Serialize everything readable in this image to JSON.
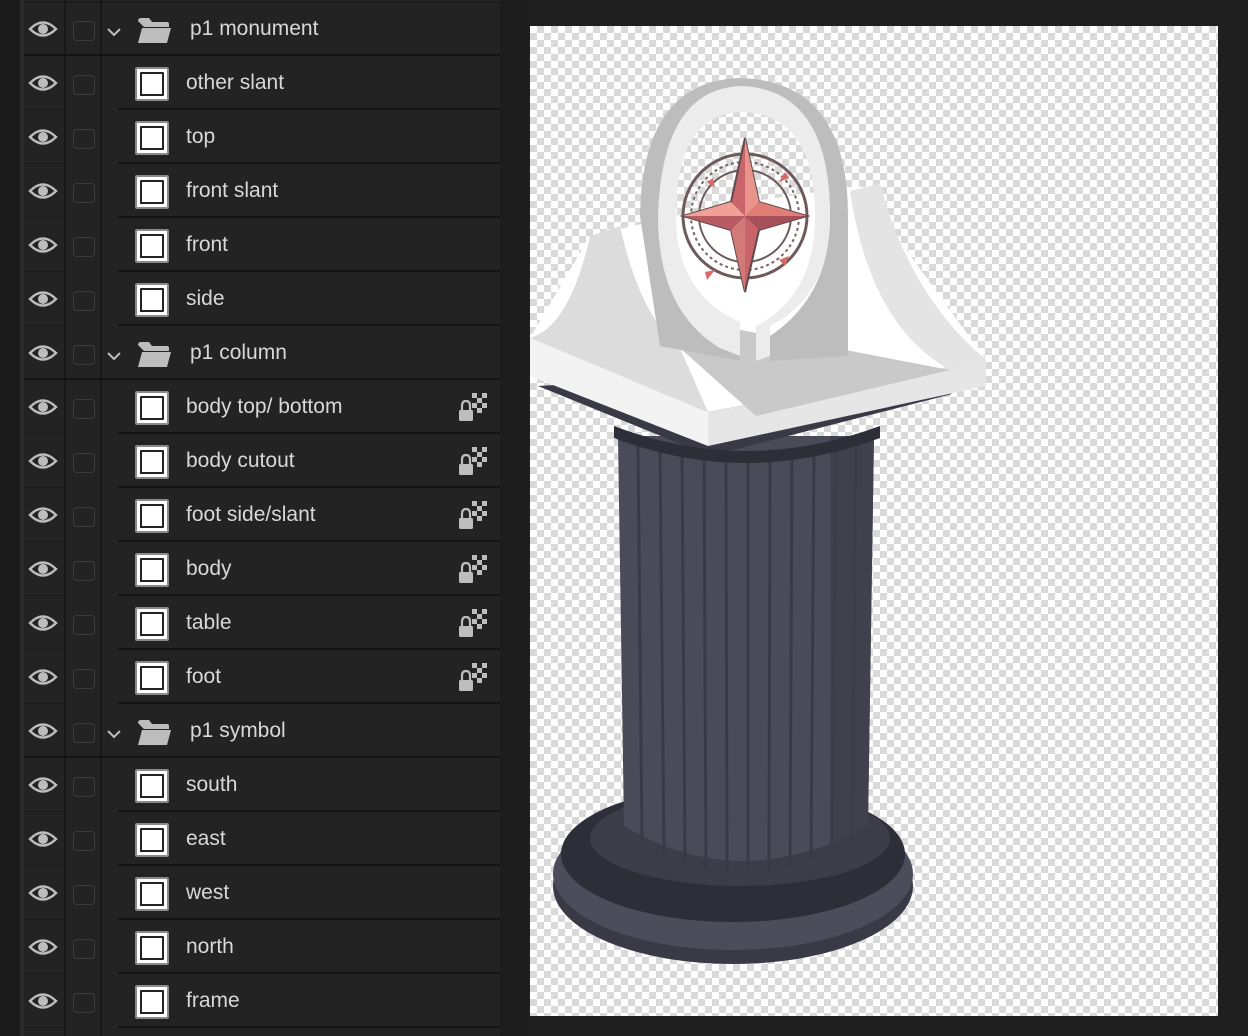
{
  "layers_panel": {
    "groups": [
      {
        "name": "p1 monument",
        "expanded": true,
        "layers": [
          {
            "name": "other slant",
            "locked": false
          },
          {
            "name": "top",
            "locked": false
          },
          {
            "name": "front slant",
            "locked": false
          },
          {
            "name": "front",
            "locked": false
          },
          {
            "name": "side",
            "locked": false
          }
        ]
      },
      {
        "name": "p1 column",
        "expanded": true,
        "layers": [
          {
            "name": "body top/ bottom",
            "locked": true
          },
          {
            "name": "body cutout",
            "locked": true
          },
          {
            "name": "foot side/slant",
            "locked": true
          },
          {
            "name": "body",
            "locked": true
          },
          {
            "name": "table",
            "locked": true
          },
          {
            "name": "foot",
            "locked": true
          }
        ]
      },
      {
        "name": "p1 symbol",
        "expanded": true,
        "layers": [
          {
            "name": "south",
            "locked": false
          },
          {
            "name": "east",
            "locked": false
          },
          {
            "name": "west",
            "locked": false
          },
          {
            "name": "north",
            "locked": false
          },
          {
            "name": "frame",
            "locked": false
          }
        ]
      }
    ]
  },
  "icons": {
    "visibility": "eye-icon",
    "group": "folder-icon",
    "expand": "chevron-down-icon",
    "lock": "transparency-lock-icon",
    "thumbnail": "layer-thumbnail-icon"
  },
  "colors": {
    "panel_bg": "#232323",
    "text": "#d8d8d8",
    "icon": "#bdbdbd",
    "column": "#4a4a56",
    "monument": "#ededed",
    "star": "#e0736c"
  },
  "canvas": {
    "content": "isometric pedestal illustration: white monument with compass-star symbol on top of a dark fluted column on transparent background"
  }
}
